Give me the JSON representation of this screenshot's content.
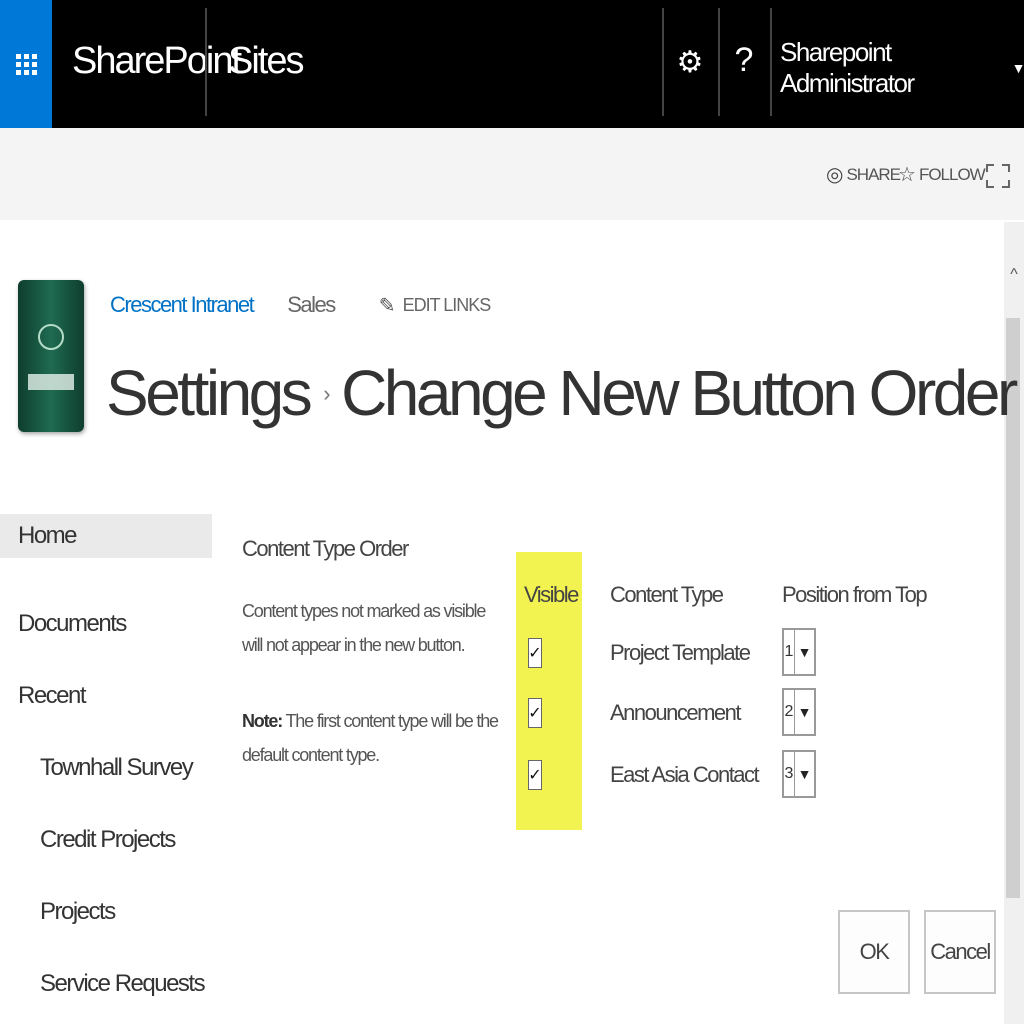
{
  "suite_bar": {
    "brand": "SharePoint",
    "sites_link": "Sites",
    "gear_glyph": "⚙",
    "help_glyph": "?",
    "user_name": "Sharepoint Administrator",
    "user_caret": "▼",
    "accent_color": "#0078d7"
  },
  "action_bar": {
    "share_label": "SHARE",
    "follow_label": "FOLLOW",
    "icons": [
      "share-icon",
      "follow-star-icon",
      "focus-mode-icon"
    ]
  },
  "header": {
    "breadcrumb": {
      "site": "Crescent Intranet",
      "subsite": "Sales",
      "edit_links": "EDIT LINKS"
    },
    "title": "Settings",
    "title_separator": "›",
    "subtitle": "Change New Button Order",
    "info_glyph": "ⓘ"
  },
  "left_nav": {
    "items": [
      {
        "label": "Home"
      },
      {
        "label": "Documents"
      },
      {
        "label": "Recent"
      },
      {
        "label": "Townhall Survey"
      },
      {
        "label": "Credit Projects"
      },
      {
        "label": "Projects"
      },
      {
        "label": "Service Requests"
      }
    ]
  },
  "content_type_order": {
    "title": "Content Type Order",
    "description": "Content types not marked as visible will not appear in the new button.",
    "note_label": "Note:",
    "note_text": "The first content type will be the default content type.",
    "columns": {
      "visible": "Visible",
      "content_type": "Content Type",
      "position": "Position from Top"
    },
    "highlight_color": "#f2f250",
    "rows": [
      {
        "visible": true,
        "check": "✓",
        "name": "Project Template",
        "position": "1"
      },
      {
        "visible": true,
        "check": "✓",
        "name": "Announcement",
        "position": "2"
      },
      {
        "visible": true,
        "check": "✓",
        "name": "East Asia Contact",
        "position": "3"
      }
    ],
    "dropdown_arrow": "▼"
  },
  "buttons": {
    "ok_label": "OK",
    "cancel_label": "Cancel"
  },
  "scrollbar": {
    "up_glyph": "^"
  }
}
